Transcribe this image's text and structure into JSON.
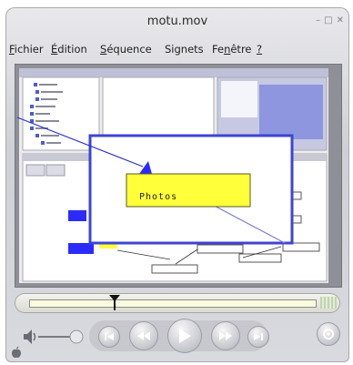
{
  "window": {
    "title": "motu.mov",
    "controls": [
      "minimize-icon",
      "maximize-icon",
      "close-icon"
    ]
  },
  "menu": {
    "items": [
      "Fichier",
      "Édition",
      "Séquence",
      "Signets",
      "Fenêtre",
      "?"
    ]
  },
  "video": {
    "zoomed_label": "Photos",
    "label_color": "#ffff3a",
    "node_color": "#2b2bff",
    "canvas_color": "#9aa0e6"
  },
  "player": {
    "progress": 0.3,
    "buttons": [
      "volume-icon",
      "go-to-start-icon",
      "rewind-icon",
      "play-icon",
      "fast-forward-icon",
      "go-to-end-icon",
      "options-icon"
    ]
  }
}
